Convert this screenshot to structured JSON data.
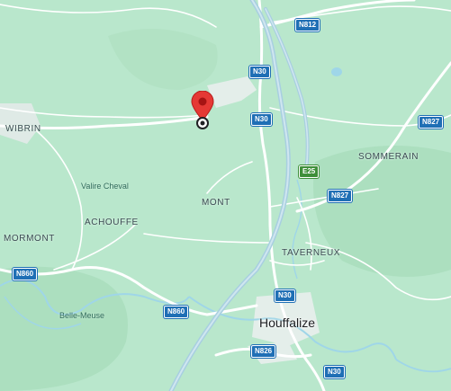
{
  "map": {
    "colors": {
      "land": "#b9e7cc",
      "forest": "#a9dfbd",
      "water": "#9fd6e8",
      "built": "#e4eeea",
      "road": "#ffffff",
      "highway": "#b8d6e6",
      "pin": "#e53935",
      "shield": "#1f6fb5",
      "e_shield": "#3f8f3a"
    },
    "villages": {
      "wibrin": "WIBRIN",
      "mont": "MONT",
      "achouffe": "ACHOUFFE",
      "mormont": "MORMONT",
      "taverneux": "TAVERNEUX",
      "sommerain": "SOMMERAIN"
    },
    "places": {
      "valire_cheval": "Valire Cheval",
      "belle_meuse": "Belle-Meuse"
    },
    "town": "Houffalize",
    "road_shields": {
      "n812": "N812",
      "n30_top": "N30",
      "n30_mid": "N30",
      "n827_right": "N827",
      "e25": "E25",
      "n827_mid": "N827",
      "n860_left": "N860",
      "n860_mid": "N860",
      "n30_houff": "N30",
      "n826": "N826",
      "n30_bottom": "N30"
    },
    "icons": {
      "pin": "location-pin-icon",
      "current_location": "current-location-icon"
    }
  }
}
